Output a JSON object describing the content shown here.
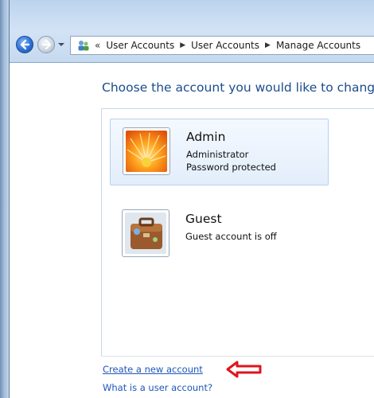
{
  "breadcrumb": {
    "lead": "«",
    "items": [
      "User Accounts",
      "User Accounts",
      "Manage Accounts"
    ],
    "icon": "user-accounts-icon"
  },
  "page": {
    "title": "Choose the account you would like to change"
  },
  "accounts": [
    {
      "name": "Admin",
      "type": "Administrator",
      "detail": "Password protected",
      "picture": "flower-icon",
      "selected": true
    },
    {
      "name": "Guest",
      "type": "Guest account is off",
      "picture": "briefcase-icon",
      "selected": false
    }
  ],
  "links": {
    "create": "Create a new account",
    "what": "What is a user account?"
  },
  "colors": {
    "title": "#1a4c8d",
    "link": "#1e56b8",
    "annotation_arrow": "#e0141e"
  }
}
